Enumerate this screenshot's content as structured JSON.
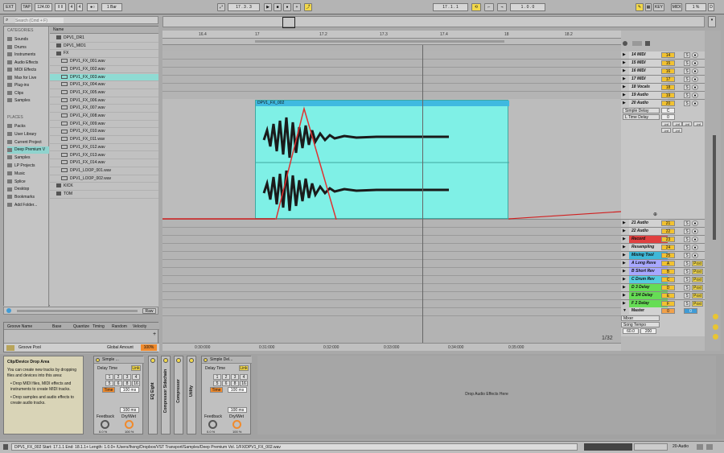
{
  "transport": {
    "ext": "EXT",
    "tap": "TAP",
    "tempo": "124.00",
    "meter_num": "4",
    "meter_den": "4",
    "quant": "1 Bar",
    "position": "17 .  3 .  3",
    "loop_start": "17 .  1 .  1",
    "loop_len": "1 .  0 .  0",
    "key": "KEY",
    "midi": "MIDI",
    "cpu": "1 %",
    "d_label": "D"
  },
  "browser": {
    "search_placeholder": "Search (Cmd + F)",
    "categories_header": "CATEGORIES",
    "categories": [
      "Sounds",
      "Drums",
      "Instruments",
      "Audio Effects",
      "MIDI Effects",
      "Max for Live",
      "Plug-ins",
      "Clips",
      "Samples"
    ],
    "places_header": "PLACES",
    "places": [
      "Packs",
      "User Library",
      "Current Project",
      "Deep Premium V",
      "Samples",
      "LP Projects",
      "Music",
      "Splice",
      "Desktop",
      "Bookmarks",
      "Add Folder..."
    ],
    "name_header": "Name",
    "files": [
      "DPV1_DR1",
      "DPV1_MID1",
      "FX",
      "DPV1_FX_001.wav",
      "DPV1_FX_002.wav",
      "DPV1_FX_003.wav",
      "DPV1_FX_004.wav",
      "DPV1_FX_005.wav",
      "DPV1_FX_006.wav",
      "DPV1_FX_007.wav",
      "DPV1_FX_008.wav",
      "DPV1_FX_009.wav",
      "DPV1_FX_010.wav",
      "DPV1_FX_011.wav",
      "DPV1_FX_012.wav",
      "DPV1_FX_013.wav",
      "DPV1_FX_014.wav",
      "DPV1_LOOP_001.wav",
      "DPV1_LOOP_002.wav",
      "KICK",
      "TOM"
    ],
    "raw": "Raw",
    "groove_cols": [
      "Groove Name",
      "Base",
      "Quantize",
      "Timing",
      "Random",
      "Velocity"
    ],
    "groove_pool": "Groove Pool",
    "global_amount": "Global Amount",
    "global_value": "100%"
  },
  "ruler": {
    "bars": [
      "16.4",
      "17",
      "17.2",
      "17.3",
      "17.4",
      "18",
      "18.2"
    ],
    "times": [
      "0:30:000",
      "0:31:000",
      "0:32:000",
      "0:33:000",
      "0:34:000",
      "0:35:000"
    ]
  },
  "clip": {
    "name": "DPV1_FX_002"
  },
  "zoom": "1/32",
  "tracks_top": [
    {
      "name": "14 MIDI",
      "num": "14"
    },
    {
      "name": "15 MIDI",
      "num": "15"
    },
    {
      "name": "16 MIDI",
      "num": "16"
    },
    {
      "name": "17 MIDI",
      "num": "17"
    },
    {
      "name": "18 Vocals",
      "num": "18"
    },
    {
      "name": "19 Audio",
      "num": "19"
    },
    {
      "name": "20 Audio",
      "num": "20"
    }
  ],
  "automation": {
    "device": "Simple Delay",
    "param": "L Time Delay",
    "c_label": "C",
    "inf": "-inf",
    "zero": "0"
  },
  "tracks_bottom": [
    {
      "name": "21 Audio",
      "num": "21",
      "color": "#d2d2d2"
    },
    {
      "name": "22 Audio",
      "num": "22",
      "color": "#d2d2d2"
    },
    {
      "name": "Record",
      "num": "23",
      "color": "#e04040"
    },
    {
      "name": "Resampling",
      "num": "24",
      "color": "#d2d2d2"
    },
    {
      "name": "Mixing Tool",
      "num": "25",
      "color": "#3fb8d8"
    },
    {
      "name": "A Long Reve",
      "num": "A",
      "color": "#a8a8ff"
    },
    {
      "name": "B Short Rev",
      "num": "B",
      "color": "#a8a8ff"
    },
    {
      "name": "C Drum Rev",
      "num": "C",
      "color": "#55cce0"
    },
    {
      "name": "D 3 Delay",
      "num": "D",
      "color": "#66dd55"
    },
    {
      "name": "E 3/4 Delay",
      "num": "E",
      "color": "#66dd55"
    },
    {
      "name": "F 2 Delay",
      "num": "F",
      "color": "#66dd55"
    }
  ],
  "master": {
    "name": "Master",
    "mixer": "Mixer",
    "song_tempo": "Song Tempo",
    "tempo_min": "60.0",
    "tempo_max": "200",
    "zero": "0"
  },
  "btns": {
    "s": "S",
    "post": "Post",
    "ab": "A"
  },
  "info": {
    "title": "Clip/Device Drop Area",
    "p1": "You can create new tracks by dropping files and devices into this area:",
    "b1": "Drop MIDI files, MIDI effects and instruments to create MIDI tracks.",
    "b2": "Drop samples and audio effects to create audio tracks."
  },
  "devices": [
    {
      "title": "Simple ...",
      "delay_time": "Delay Time",
      "link": "Link",
      "nums": [
        "1",
        "2",
        "3",
        "4",
        "5",
        "6",
        "8",
        "16"
      ],
      "time": "Time",
      "time_val": "100 ms",
      "time_r": "100 ms",
      "feedback": "Feedback",
      "drywet": "Dry/Wet",
      "fb_val": "0.0 %",
      "dw_val": "100 %"
    },
    {
      "title": "Simple Del...",
      "delay_time": "Delay Time",
      "link": "Link",
      "nums": [
        "1",
        "2",
        "3",
        "4",
        "5",
        "6",
        "8",
        "16"
      ],
      "time": "Time",
      "time_val": "100 ms",
      "time_r": "100 ms",
      "feedback": "Feedback",
      "drywet": "Dry/Wet",
      "fb_val": "0.0 %",
      "dw_val": "100 %"
    }
  ],
  "folded_devices": [
    "EQ Eight",
    "Compressor Sidechain",
    "Compressor",
    "Utility"
  ],
  "drop_hint": "Drop Audio Effects Here",
  "status": {
    "text": "DPV1_FX_002  Start: 17.1.1   End: 18.1.1+   Length: 1.0.0+  /Users/lhong/Dropbox/VST Transport/Samples/Deep Premium Vol. 1/FX/DPV1_FX_002.wav",
    "track": "20-Audio"
  }
}
